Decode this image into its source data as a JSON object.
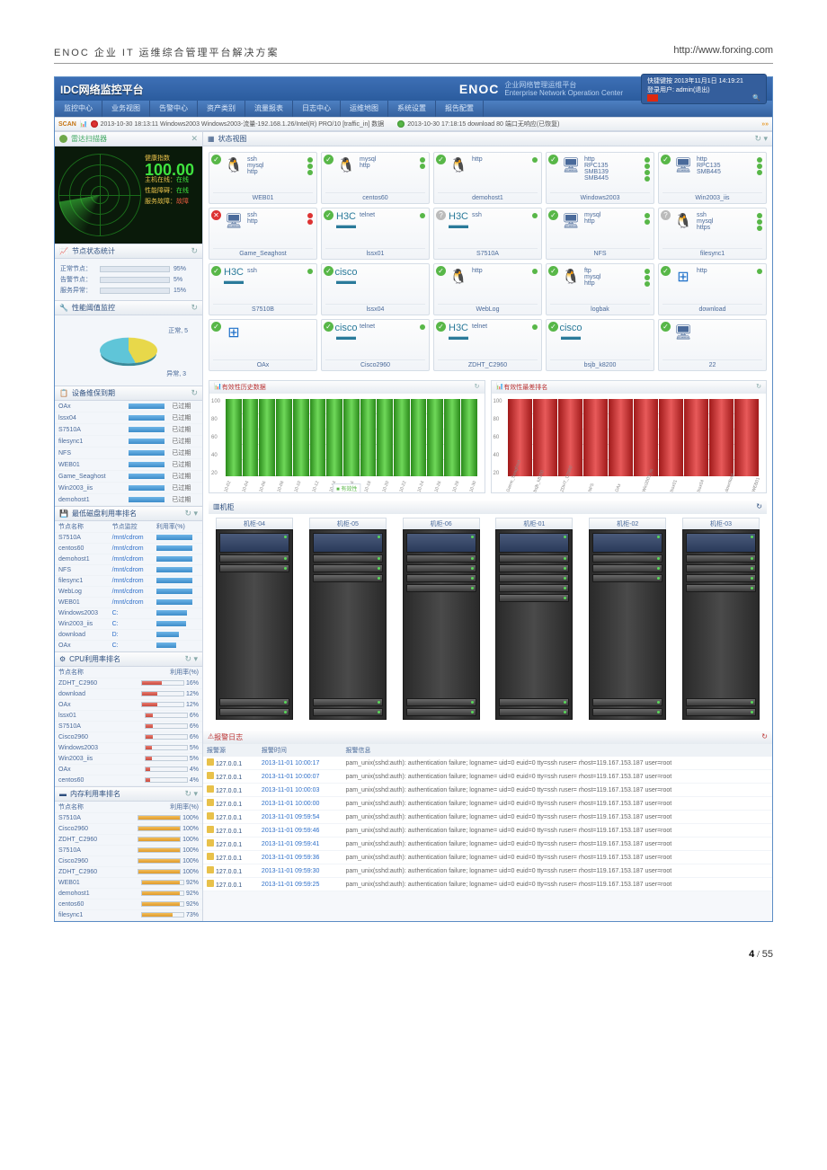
{
  "doc": {
    "title": "ENOC 企业 IT 运维综合管理平台解决方案",
    "url": "http://www.forxing.com",
    "page_cur": "4",
    "page_total": "55"
  },
  "header": {
    "brand": "IDC网络监控平台",
    "enoc_logo": "ENOC",
    "enoc_sub1": "企业网络管理运维平台",
    "enoc_sub2": "Enterprise Network Operation Center",
    "quick": "快捷键按 2013年11月1日 14:19:21",
    "login": "登录用户: admin(退出)"
  },
  "menu": [
    "监控中心",
    "业务视图",
    "告警中心",
    "资产类别",
    "流量报表",
    "日志中心",
    "运维地图",
    "系统设置",
    "报告配置"
  ],
  "scan": {
    "tag": "SCAN",
    "msg1": "2013-10-30 18:13:11 Windows2003 Windows2003-流量-192.168.1.26/Intel(R) PRO/10 [traffic_in] 数据",
    "msg2": "2013-10-30 17:18:15 download 80 端口无响应(已恢复)"
  },
  "radar": {
    "title": "雷达扫描器",
    "health_label": "健康指数",
    "health_value": "100.00",
    "rows": [
      [
        "主机在线：",
        "在线"
      ],
      [
        "性能障碍：",
        "在线"
      ],
      [
        "服务故障：",
        "故障"
      ]
    ]
  },
  "node_stat": {
    "title": "节点状态统计",
    "rows": [
      [
        "正常节点：",
        95,
        "95%"
      ],
      [
        "告警节点：",
        5,
        "5%"
      ],
      [
        "服务异常：",
        15,
        "15%"
      ]
    ]
  },
  "perf": {
    "title": "性能阈值监控",
    "labels": [
      "正常, 5",
      "异常, 3"
    ]
  },
  "maint": {
    "title": "设备维保到期",
    "rows": [
      "OAx",
      "lssx04",
      "S7510A",
      "filesync1",
      "NFS",
      "WEB01",
      "Game_Seaghost",
      "Win2003_iis",
      "demohost1"
    ],
    "status": "已过期"
  },
  "disk": {
    "title": "最低磁盘利用率排名",
    "cols": [
      "节点名称",
      "节点监控",
      "利用率(%)"
    ],
    "rows": [
      [
        "S7510A",
        "/mnt/cdrom",
        100
      ],
      [
        "centos60",
        "/mnt/cdrom",
        100
      ],
      [
        "demohost1",
        "/mnt/cdrom",
        100
      ],
      [
        "NFS",
        "/mnt/cdrom",
        100
      ],
      [
        "filesync1",
        "/mnt/cdrom",
        100
      ],
      [
        "WebLog",
        "/mnt/cdrom",
        100
      ],
      [
        "WEB01",
        "/mnt/cdrom",
        100
      ],
      [
        "Windows2003",
        "C:",
        85
      ],
      [
        "Win2003_iis",
        "C:",
        82
      ],
      [
        "download",
        "D:",
        62
      ],
      [
        "OAx",
        "C:",
        55
      ]
    ]
  },
  "cpu": {
    "title": "CPU利用率排名",
    "cols": [
      "节点名称",
      "利用率(%)"
    ],
    "rows": [
      [
        "ZDHT_C2960",
        16
      ],
      [
        "download",
        12
      ],
      [
        "OAx",
        12
      ],
      [
        "lssx01",
        6
      ],
      [
        "S7510A",
        6
      ],
      [
        "Cisco2960",
        6
      ],
      [
        "Windows2003",
        5
      ],
      [
        "Win2003_iis",
        5
      ],
      [
        "OAx",
        4
      ],
      [
        "centos60",
        4
      ]
    ]
  },
  "mem": {
    "title": "内存利用率排名",
    "cols": [
      "节点名称",
      "利用率(%)"
    ],
    "rows": [
      [
        "S7510A",
        100
      ],
      [
        "Cisco2960",
        100
      ],
      [
        "ZDHT_C2960",
        100
      ],
      [
        "S7510A",
        100
      ],
      [
        "Cisco2960",
        100
      ],
      [
        "ZDHT_C2960",
        100
      ],
      [
        "WEB01",
        92
      ],
      [
        "demohost1",
        92
      ],
      [
        "centos60",
        92
      ],
      [
        "filesync1",
        73
      ]
    ]
  },
  "status_view": {
    "title": "状态视图"
  },
  "nodes": [
    {
      "name": "WEB01",
      "os": "tux",
      "state": "ok",
      "svcs": [
        [
          "ssh",
          "g"
        ],
        [
          "mysql",
          "g"
        ],
        [
          "http",
          "g"
        ]
      ]
    },
    {
      "name": "centos60",
      "os": "tux",
      "state": "ok",
      "svcs": [
        [
          "mysql",
          "g"
        ],
        [
          "http",
          "g"
        ]
      ]
    },
    {
      "name": "demohost1",
      "os": "tux",
      "state": "ok",
      "svcs": [
        [
          "http",
          "g"
        ]
      ]
    },
    {
      "name": "Windows2003",
      "os": "pc",
      "state": "ok",
      "svcs": [
        [
          "http",
          "g"
        ],
        [
          "RPC135",
          "g"
        ],
        [
          "SMB139",
          "g"
        ],
        [
          "SMB445",
          "g"
        ]
      ]
    },
    {
      "name": "Win2003_iis",
      "os": "pc",
      "state": "ok",
      "svcs": [
        [
          "http",
          "g"
        ],
        [
          "RPC135",
          "g"
        ],
        [
          "SMB445",
          "g"
        ]
      ]
    },
    {
      "name": "Game_Seaghost",
      "os": "pc",
      "state": "err",
      "svcs": [
        [
          "ssh",
          "r"
        ],
        [
          "http",
          "r"
        ]
      ]
    },
    {
      "name": "lssx01",
      "os": "net",
      "brand": "H3C",
      "state": "ok",
      "svcs": [
        [
          "telnet",
          "g"
        ]
      ]
    },
    {
      "name": "S7510A",
      "os": "net",
      "brand": "H3C",
      "state": "warn",
      "svcs": [
        [
          "ssh",
          "g"
        ]
      ]
    },
    {
      "name": "NFS",
      "os": "pc",
      "state": "ok",
      "svcs": [
        [
          "mysql",
          "g"
        ],
        [
          "http",
          "g"
        ]
      ]
    },
    {
      "name": "filesync1",
      "os": "tux",
      "state": "warn",
      "svcs": [
        [
          "ssh",
          "g"
        ],
        [
          "mysql",
          "g"
        ],
        [
          "https",
          "g"
        ]
      ]
    },
    {
      "name": "S7510B",
      "os": "net",
      "brand": "H3C",
      "state": "ok",
      "svcs": [
        [
          "ssh",
          "g"
        ]
      ]
    },
    {
      "name": "lssx04",
      "os": "net",
      "brand": "cisco",
      "state": "ok",
      "svcs": []
    },
    {
      "name": "WebLog",
      "os": "tux",
      "state": "ok",
      "svcs": [
        [
          "http",
          "g"
        ]
      ]
    },
    {
      "name": "logbak",
      "os": "tux",
      "state": "ok",
      "svcs": [
        [
          "ftp",
          "g"
        ],
        [
          "mysql",
          "g"
        ],
        [
          "http",
          "g"
        ]
      ]
    },
    {
      "name": "download",
      "os": "win",
      "state": "ok",
      "svcs": [
        [
          "http",
          "g"
        ]
      ]
    },
    {
      "name": "OAx",
      "os": "win",
      "state": "ok",
      "svcs": []
    },
    {
      "name": "Cisco2960",
      "os": "net",
      "brand": "cisco",
      "state": "ok",
      "svcs": [
        [
          "telnet",
          "g"
        ]
      ]
    },
    {
      "name": "ZDHT_C2960",
      "os": "net",
      "brand": "H3C",
      "state": "ok",
      "svcs": [
        [
          "telnet",
          "g"
        ]
      ]
    },
    {
      "name": "bsjb_k8200",
      "os": "net",
      "brand": "cisco",
      "state": "ok",
      "svcs": []
    },
    {
      "name": "22",
      "os": "pc",
      "state": "ok",
      "svcs": []
    }
  ],
  "chart_data": [
    {
      "type": "bar",
      "title": "有效性历史数据",
      "ylim": [
        0,
        100
      ],
      "yticks": [
        20,
        40,
        60,
        80,
        100
      ],
      "x": [
        "10-02",
        "10-04",
        "10-06",
        "10-08",
        "10-10",
        "10-12",
        "10-14",
        "10-16",
        "10-18",
        "10-20",
        "10-22",
        "10-24",
        "10-26",
        "10-28",
        "10-30"
      ],
      "series": [
        {
          "name": "有效性",
          "values": [
            100,
            100,
            100,
            100,
            100,
            100,
            100,
            100,
            100,
            100,
            100,
            100,
            100,
            100,
            100
          ]
        }
      ],
      "legend": "有效性"
    },
    {
      "type": "bar",
      "title": "有效性最差排名",
      "ylim": [
        0,
        100
      ],
      "yticks": [
        20,
        40,
        60,
        80,
        100
      ],
      "x": [
        "Game_Seaghost",
        "bsjb_k8200",
        "ZDHT_C2960",
        "NFS",
        "OAx",
        "Win2003_iis",
        "lssx01",
        "lssx04",
        "download",
        "WEB01"
      ],
      "series": [
        {
          "name": "",
          "values": [
            100,
            100,
            100,
            100,
            100,
            100,
            100,
            100,
            100,
            100
          ]
        }
      ]
    }
  ],
  "racks": {
    "title": "机柜",
    "names": [
      "机柜-04",
      "机柜-05",
      "机柜-06",
      "机柜-01",
      "机柜-02",
      "机柜-03"
    ]
  },
  "alarm": {
    "title": "报警日志",
    "cols": [
      "报警源",
      "报警时间",
      "报警信息"
    ],
    "rows": [
      [
        "127.0.0.1",
        "2013-11-01 10:00:17",
        "pam_unix(sshd:auth): authentication failure; logname= uid=0 euid=0 tty=ssh ruser= rhost=119.167.153.187 user=root"
      ],
      [
        "127.0.0.1",
        "2013-11-01 10:00:07",
        "pam_unix(sshd:auth): authentication failure; logname= uid=0 euid=0 tty=ssh ruser= rhost=119.167.153.187 user=root"
      ],
      [
        "127.0.0.1",
        "2013-11-01 10:00:03",
        "pam_unix(sshd:auth): authentication failure; logname= uid=0 euid=0 tty=ssh ruser= rhost=119.167.153.187 user=root"
      ],
      [
        "127.0.0.1",
        "2013-11-01 10:00:00",
        "pam_unix(sshd:auth): authentication failure; logname= uid=0 euid=0 tty=ssh ruser= rhost=119.167.153.187 user=root"
      ],
      [
        "127.0.0.1",
        "2013-11-01 09:59:54",
        "pam_unix(sshd:auth): authentication failure; logname= uid=0 euid=0 tty=ssh ruser= rhost=119.167.153.187 user=root"
      ],
      [
        "127.0.0.1",
        "2013-11-01 09:59:46",
        "pam_unix(sshd:auth): authentication failure; logname= uid=0 euid=0 tty=ssh ruser= rhost=119.167.153.187 user=root"
      ],
      [
        "127.0.0.1",
        "2013-11-01 09:59:41",
        "pam_unix(sshd:auth): authentication failure; logname= uid=0 euid=0 tty=ssh ruser= rhost=119.167.153.187 user=root"
      ],
      [
        "127.0.0.1",
        "2013-11-01 09:59:36",
        "pam_unix(sshd:auth): authentication failure; logname= uid=0 euid=0 tty=ssh ruser= rhost=119.167.153.187 user=root"
      ],
      [
        "127.0.0.1",
        "2013-11-01 09:59:30",
        "pam_unix(sshd:auth): authentication failure; logname= uid=0 euid=0 tty=ssh ruser= rhost=119.167.153.187 user=root"
      ],
      [
        "127.0.0.1",
        "2013-11-01 09:59:25",
        "pam_unix(sshd:auth): authentication failure; logname= uid=0 euid=0 tty=ssh ruser= rhost=119.167.153.187 user=root"
      ]
    ]
  }
}
